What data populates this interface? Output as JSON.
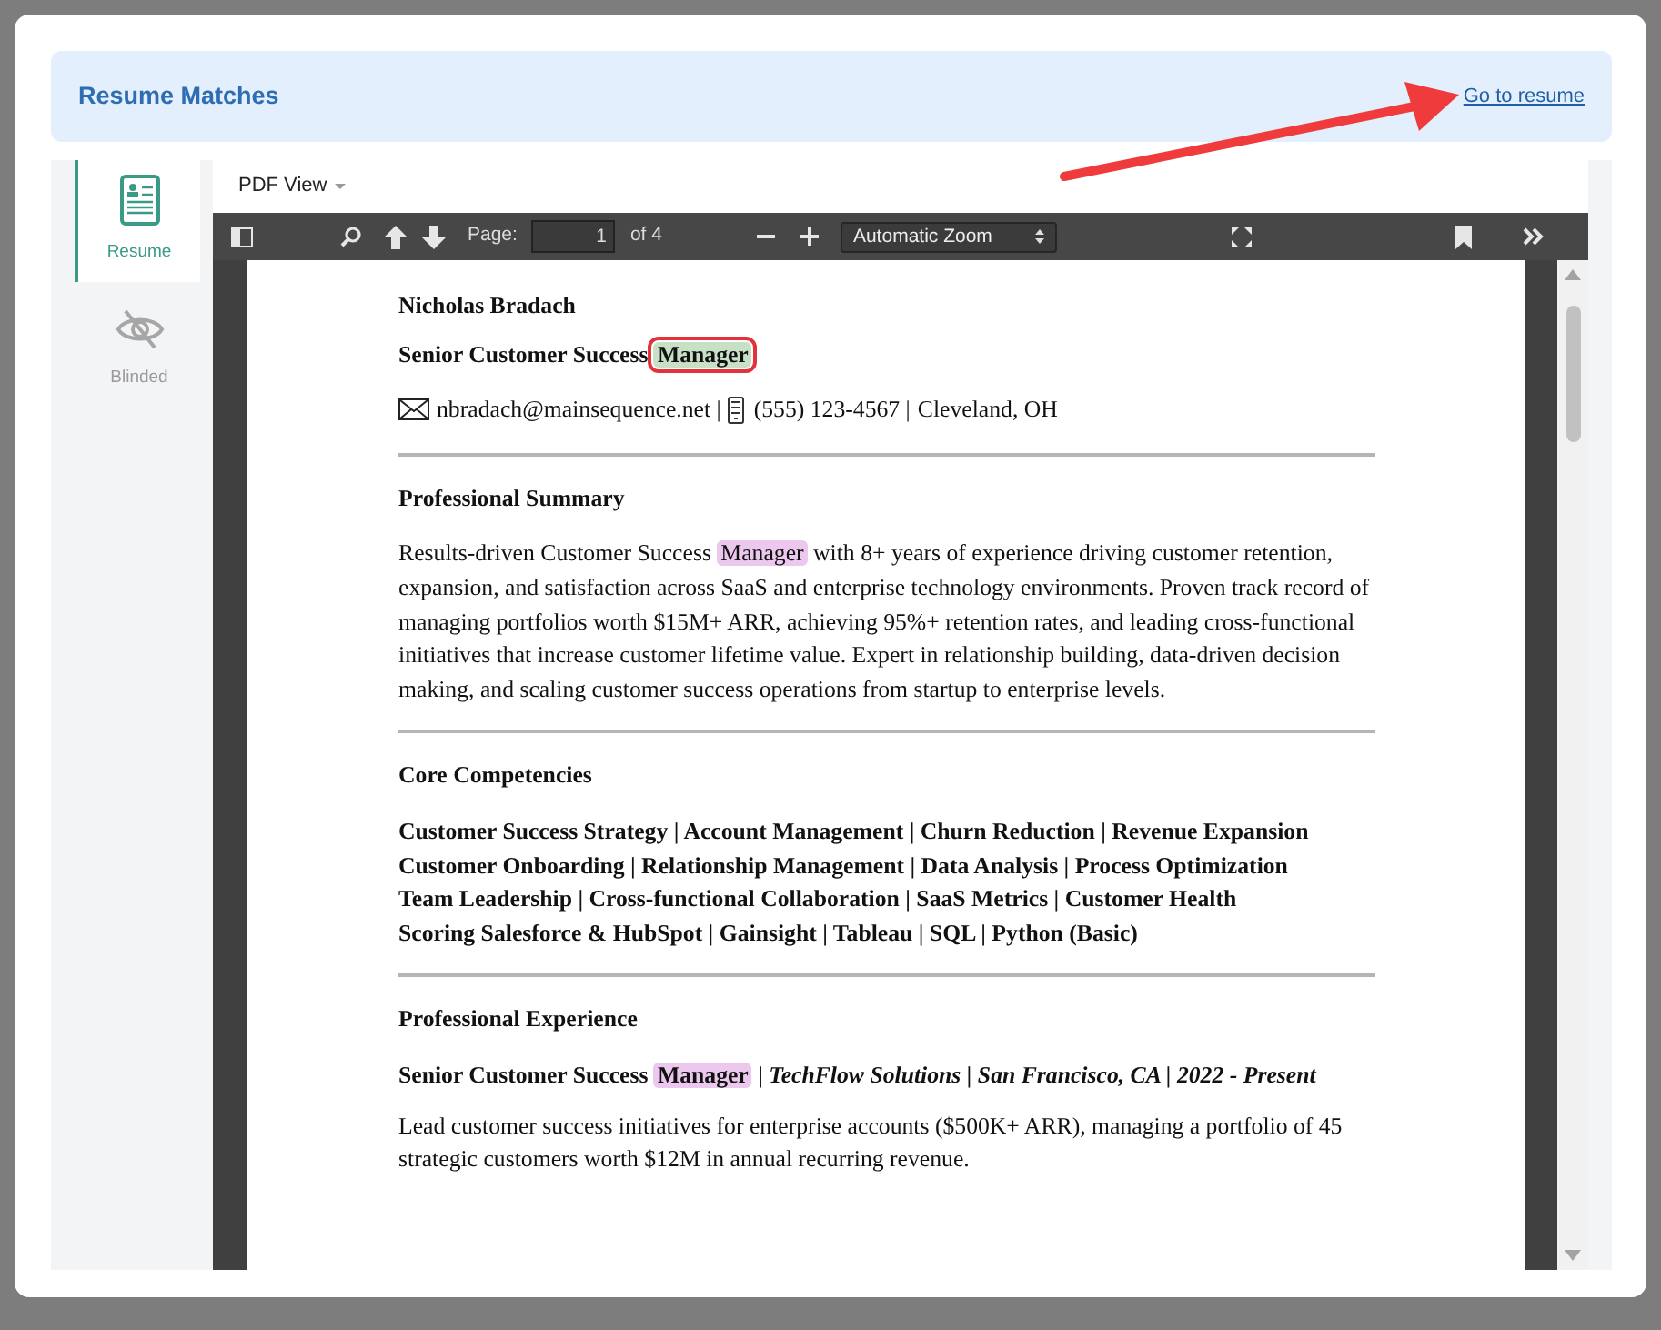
{
  "dialog": {
    "title": "Resume Matches",
    "link": "Go to resume"
  },
  "side_tabs": [
    {
      "kind": "resume",
      "label": "Resume",
      "selected": true
    },
    {
      "kind": "blinded",
      "label": "Blinded",
      "selected": false
    }
  ],
  "view_menu": "PDF View",
  "pdf_toolbar": {
    "page_label": "Page:",
    "page": "1",
    "page_count": "of 4",
    "zoom": "Automatic Zoom"
  },
  "document": [
    {
      "kind": "name",
      "segments": [
        {
          "text": "Nicholas Bradach"
        }
      ]
    },
    {
      "kind": "title",
      "segments": [
        {
          "text": "Senior Customer Success "
        },
        {
          "text": "Manager",
          "color": "#c8e0c6",
          "outlined": true
        }
      ]
    },
    {
      "kind": "contact",
      "segments": [
        {
          "kind": "mail",
          "text": "nbradach@mainsequence.net |"
        },
        {
          "kind": "phone",
          "text": "(555) 123-4567 |"
        },
        {
          "kind": "plain",
          "text": "Cleveland, OH"
        }
      ]
    },
    {
      "kind": "rule"
    },
    {
      "kind": "heading",
      "segments": [
        {
          "text": "Professional Summary"
        }
      ]
    },
    {
      "kind": "para",
      "segments": [
        {
          "text": "Results-driven Customer Success "
        },
        {
          "text": "Manager",
          "color": "#ecc8ee"
        },
        {
          "text": " with 8+ years of experience driving customer retention, expansion, and satisfaction across SaaS and enterprise technology environments. Proven track record of managing portfolios worth $15M+ ARR, achieving 95%+ retention rates, and leading cross-functional initiatives that increase customer lifetime value. Expert in relationship building, data-driven decision making, and scaling customer success operations from startup to enterprise levels."
        }
      ]
    },
    {
      "kind": "rule"
    },
    {
      "kind": "heading",
      "segments": [
        {
          "text": "Core Competencies"
        }
      ]
    },
    {
      "kind": "skills",
      "segments": [
        {
          "text": "Customer Success Strategy | Account Management | Churn Reduction | Revenue Expansion"
        }
      ]
    },
    {
      "kind": "skills",
      "segments": [
        {
          "text": "Customer Onboarding | Relationship Management | Data Analysis | Process Optimization"
        }
      ]
    },
    {
      "kind": "skills",
      "segments": [
        {
          "text": "Team Leadership | Cross-functional Collaboration | SaaS Metrics | Customer Health"
        }
      ]
    },
    {
      "kind": "skills",
      "segments": [
        {
          "text": "Scoring Salesforce & HubSpot | Gainsight | Tableau | SQL | Python (Basic)"
        }
      ]
    },
    {
      "kind": "rule"
    },
    {
      "kind": "heading",
      "segments": [
        {
          "text": "Professional Experience"
        }
      ]
    },
    {
      "kind": "title",
      "segments": [
        {
          "text": "Senior Customer Success "
        },
        {
          "text": "Manager",
          "color": "#ecc8ee"
        },
        {
          "text": " | *TechFlow Solutions | San Francisco, CA | 2022 - Present*"
        }
      ]
    },
    {
      "kind": "para",
      "segments": [
        {
          "text": "Lead customer success initiatives for enterprise accounts ($500K+ ARR), managing a portfolio of 45 strategic customers worth $12M in annual recurring revenue."
        }
      ]
    }
  ],
  "annotations": {
    "arrow": true
  }
}
